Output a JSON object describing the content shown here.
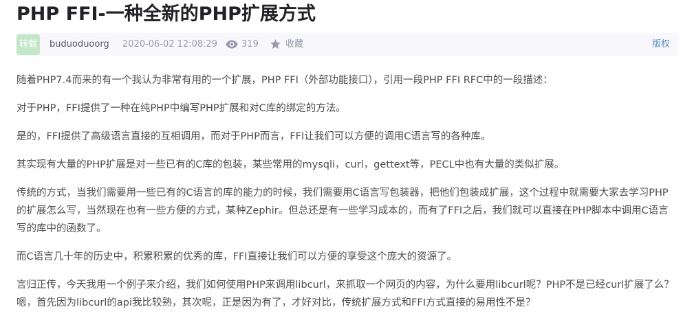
{
  "article": {
    "title": "PHP FFI-一种全新的PHP扩展方式",
    "meta": {
      "badge": "转载",
      "author": "buduoduoorg",
      "time": "2020-06-02 12:08:29",
      "views": "319",
      "collect_label": "收藏",
      "copyright_label": "版权"
    },
    "paragraphs": [
      "随着PHP7.4而来的有一个我认为非常有用的一个扩展，PHP FFI（外部功能接口），引用一段PHP FFI RFC中的一段描述：",
      "对于PHP，FFI提供了一种在纯PHP中编写PHP扩展和对C库的绑定的方法。",
      "是的，FFI提供了高级语言直接的互相调用，而对于PHP而言，FFI让我们可以方便的调用C语言写的各种库。",
      "其实现有大量的PHP扩展是对一些已有的C库的包装，某些常用的mysqli，curl，gettext等，PECL中也有大量的类似扩展。",
      "传统的方式，当我们需要用一些已有的C语言的库的能力的时候，我们需要用C语言写包装器，把他们包装成扩展，这个过程中就需要大家去学习PHP的扩展怎么写，当然现在也有一些方便的方式，某种Zephir。但总还是有一些学习成本的，而有了FFI之后，我们就可以直接在PHP脚本中调用C语言写的库中的函数了。",
      "而C语言几十年的历史中，积累积累的优秀的库，FFI直接让我们可以方便的享受这个庞大的资源了。",
      "言归正传，今天我用一个例子来介绍，我们如何使用PHP来调用libcurl，来抓取一个网页的内容，为什么要用libcurl呢？PHP不是已经curl扩展了么？嗯，首先因为libcurl的api我比较熟，其次呢，正是因为有了，才好对比，传统扩展方式和FFI方式直接的易用性不是？"
    ]
  },
  "icons": {
    "views": "eye-icon",
    "collect": "star-icon"
  },
  "colors": {
    "badge_bg": "#c2e8c8",
    "meta_bg": "#f7f7fc",
    "link": "#5e8fc7",
    "text": "#4d4d4d",
    "title": "#222226"
  }
}
